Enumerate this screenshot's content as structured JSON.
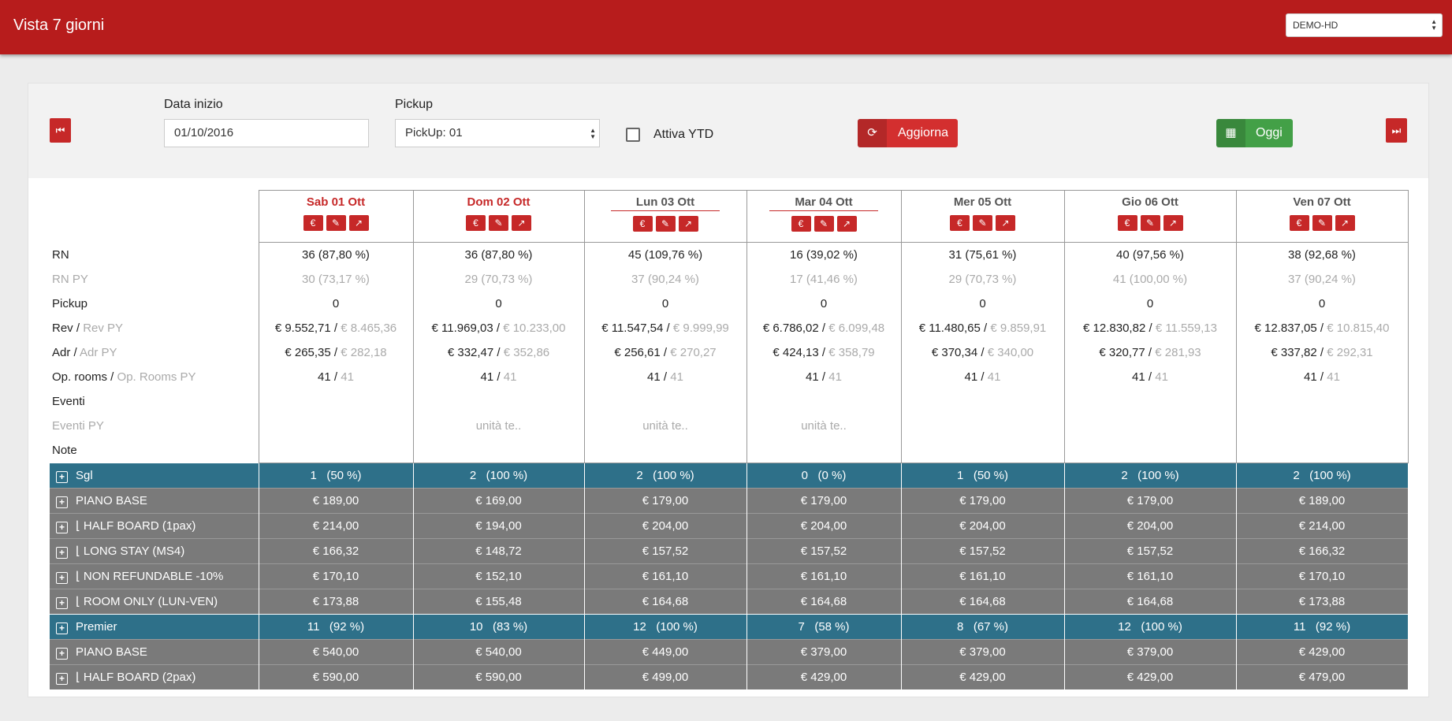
{
  "header": {
    "title": "Vista 7 giorni",
    "hotel_select": "DEMO-HD"
  },
  "filters": {
    "date_label": "Data inizio",
    "date_value": "01/10/2016",
    "pickup_label": "Pickup",
    "pickup_value": "PickUp: 01",
    "ytd_label": "Attiva YTD",
    "refresh_label": "Aggiorna",
    "today_label": "Oggi"
  },
  "days": [
    {
      "label": "Sab 01 Ott",
      "rn": "36 (87,80 %)",
      "rn_py": "30 (73,17 %)",
      "pickup": "0",
      "rev": "€ 9.552,71",
      "rev_py": "€ 8.465,36",
      "adr": "€ 265,35",
      "adr_py": "€ 282,18",
      "op": "41",
      "op_py": "41",
      "eventi": "",
      "eventi_py": "",
      "note": ""
    },
    {
      "label": "Dom 02 Ott",
      "rn": "36 (87,80 %)",
      "rn_py": "29 (70,73 %)",
      "pickup": "0",
      "rev": "€ 11.969,03",
      "rev_py": "€ 10.233,00",
      "adr": "€ 332,47",
      "adr_py": "€ 352,86",
      "op": "41",
      "op_py": "41",
      "eventi": "",
      "eventi_py": "unità te..",
      "note": ""
    },
    {
      "label": "Lun 03 Ott",
      "rn": "45 (109,76 %)",
      "rn_py": "37 (90,24 %)",
      "pickup": "0",
      "rev": "€ 11.547,54",
      "rev_py": "€ 9.999,99",
      "adr": "€ 256,61",
      "adr_py": "€ 270,27",
      "op": "41",
      "op_py": "41",
      "eventi": "",
      "eventi_py": "unità te..",
      "note": ""
    },
    {
      "label": "Mar 04 Ott",
      "rn": "16 (39,02 %)",
      "rn_py": "17 (41,46 %)",
      "pickup": "0",
      "rev": "€ 6.786,02",
      "rev_py": "€ 6.099,48",
      "adr": "€ 424,13",
      "adr_py": "€ 358,79",
      "op": "41",
      "op_py": "41",
      "eventi": "",
      "eventi_py": "unità te..",
      "note": ""
    },
    {
      "label": "Mer 05 Ott",
      "rn": "31 (75,61 %)",
      "rn_py": "29 (70,73 %)",
      "pickup": "0",
      "rev": "€ 11.480,65",
      "rev_py": "€ 9.859,91",
      "adr": "€ 370,34",
      "adr_py": "€ 340,00",
      "op": "41",
      "op_py": "41",
      "eventi": "",
      "eventi_py": "",
      "note": ""
    },
    {
      "label": "Gio 06 Ott",
      "rn": "40 (97,56 %)",
      "rn_py": "41 (100,00 %)",
      "pickup": "0",
      "rev": "€ 12.830,82",
      "rev_py": "€ 11.559,13",
      "adr": "€ 320,77",
      "adr_py": "€ 281,93",
      "op": "41",
      "op_py": "41",
      "eventi": "",
      "eventi_py": "",
      "note": ""
    },
    {
      "label": "Ven 07 Ott",
      "rn": "38 (92,68 %)",
      "rn_py": "37 (90,24 %)",
      "pickup": "0",
      "rev": "€ 12.837,05",
      "rev_py": "€ 10.815,40",
      "adr": "€ 337,82",
      "adr_py": "€ 292,31",
      "op": "41",
      "op_py": "41",
      "eventi": "",
      "eventi_py": "",
      "note": ""
    }
  ],
  "row_labels": {
    "rn": "RN",
    "rn_py": "RN PY",
    "pickup": "Pickup",
    "rev": "Rev /",
    "rev_py": "Rev PY",
    "adr": "Adr /",
    "adr_py": "Adr PY",
    "op": "Op. rooms /",
    "op_py": "Op. Rooms PY",
    "eventi": "Eventi",
    "eventi_py": "Eventi PY",
    "note": "Note"
  },
  "separator": " / ",
  "room_groups": [
    {
      "name": "Sgl",
      "values": [
        "1   (50 %)",
        "2   (100 %)",
        "2   (100 %)",
        "0   (0 %)",
        "1   (50 %)",
        "2   (100 %)",
        "2   (100 %)"
      ],
      "rates": [
        {
          "prefix": "",
          "name": "PIANO BASE",
          "values": [
            "€ 189,00",
            "€ 169,00",
            "€ 179,00",
            "€ 179,00",
            "€ 179,00",
            "€ 179,00",
            "€ 189,00"
          ]
        },
        {
          "prefix": "⌊",
          "name": "HALF BOARD (1pax)",
          "values": [
            "€ 214,00",
            "€ 194,00",
            "€ 204,00",
            "€ 204,00",
            "€ 204,00",
            "€ 204,00",
            "€ 214,00"
          ]
        },
        {
          "prefix": "⌊",
          "name": "LONG STAY (MS4)",
          "values": [
            "€ 166,32",
            "€ 148,72",
            "€ 157,52",
            "€ 157,52",
            "€ 157,52",
            "€ 157,52",
            "€ 166,32"
          ]
        },
        {
          "prefix": "⌊",
          "name": "NON REFUNDABLE -10%",
          "values": [
            "€ 170,10",
            "€ 152,10",
            "€ 161,10",
            "€ 161,10",
            "€ 161,10",
            "€ 161,10",
            "€ 170,10"
          ]
        },
        {
          "prefix": "⌊",
          "name": "ROOM ONLY (LUN-VEN)",
          "values": [
            "€ 173,88",
            "€ 155,48",
            "€ 164,68",
            "€ 164,68",
            "€ 164,68",
            "€ 164,68",
            "€ 173,88"
          ]
        }
      ]
    },
    {
      "name": "Premier",
      "values": [
        "11   (92 %)",
        "10   (83 %)",
        "12   (100 %)",
        "7   (58 %)",
        "8   (67 %)",
        "12   (100 %)",
        "11   (92 %)"
      ],
      "rates": [
        {
          "prefix": "",
          "name": "PIANO BASE",
          "values": [
            "€ 540,00",
            "€ 540,00",
            "€ 449,00",
            "€ 379,00",
            "€ 379,00",
            "€ 379,00",
            "€ 429,00"
          ]
        },
        {
          "prefix": "⌊",
          "name": "HALF BOARD (2pax)",
          "values": [
            "€ 590,00",
            "€ 590,00",
            "€ 499,00",
            "€ 429,00",
            "€ 429,00",
            "€ 429,00",
            "€ 479,00"
          ]
        }
      ]
    }
  ]
}
